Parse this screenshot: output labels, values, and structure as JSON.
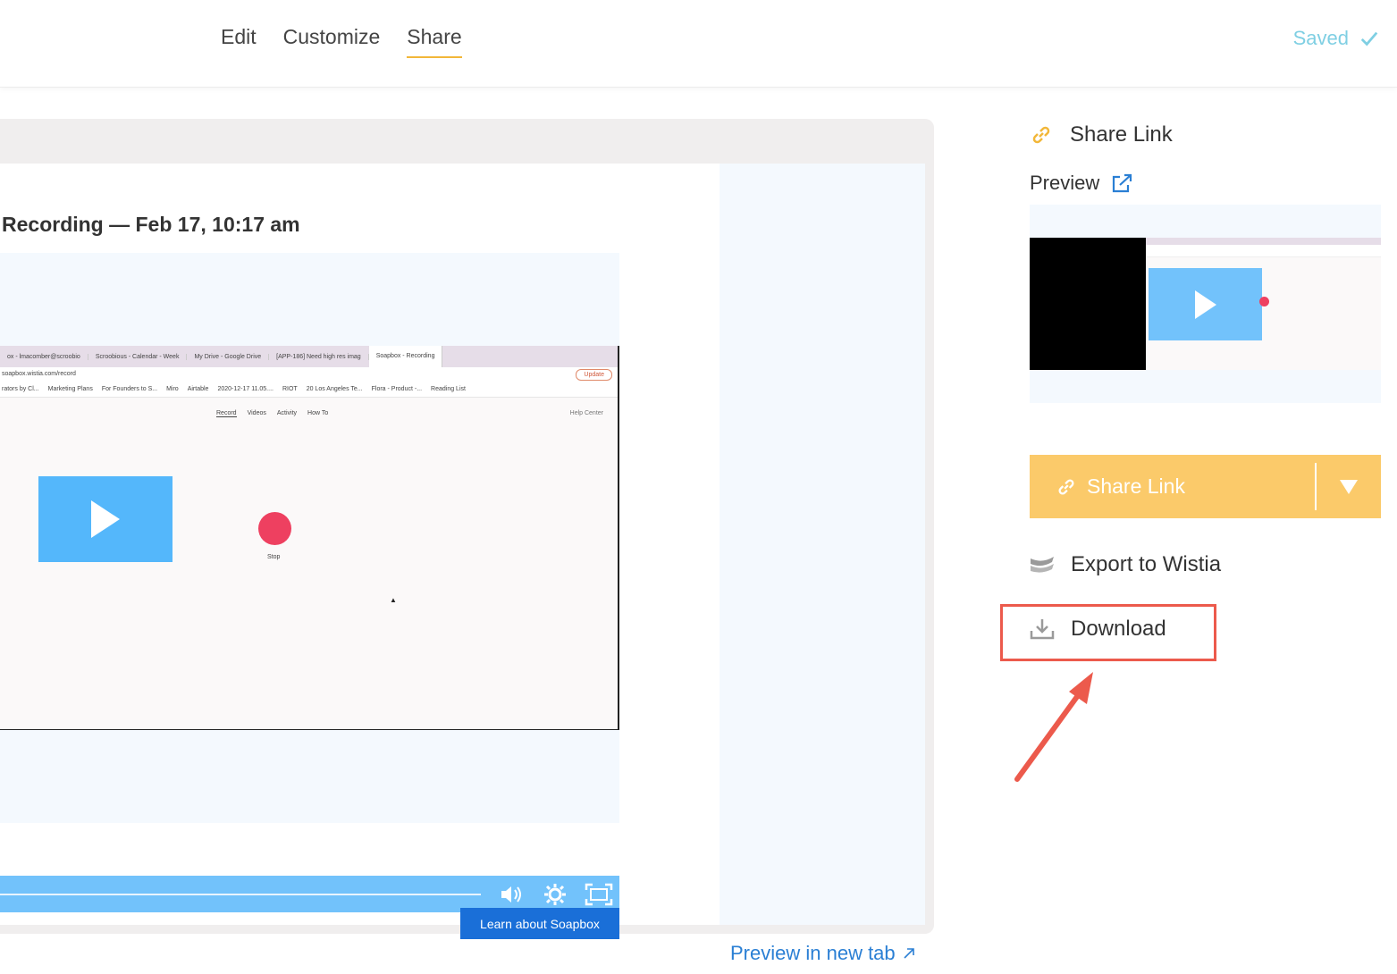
{
  "topbar": {
    "tabs": [
      {
        "label": "Edit",
        "active": false
      },
      {
        "label": "Customize",
        "active": false
      },
      {
        "label": "Share",
        "active": true
      }
    ],
    "saved_label": "Saved"
  },
  "preview": {
    "recording_title": "Recording — Feb 17, 10:17 am",
    "browser_tabs": [
      "ox - lmacomber@scroobio",
      "Scroobious - Calendar - Week",
      "My Drive - Google Drive",
      "[APP-186] Need high res imag",
      "Soapbox - Recording"
    ],
    "browser_url": "soapbox.wistia.com/record",
    "browser_update": "Update",
    "bookmarks": [
      "rators by Cl...",
      "Marketing Plans",
      "For Founders to S...",
      "Miro",
      "Airtable",
      "2020-12-17 11.05....",
      "RIOT",
      "20 Los Angeles Te...",
      "Flora - Product -...",
      "Reading List"
    ],
    "app_nav": [
      "Record",
      "Videos",
      "Activity",
      "How To"
    ],
    "app_help": "Help Center",
    "stop_label": "Stop",
    "learn_button": "Learn about Soapbox",
    "preview_new_tab": "Preview in new tab"
  },
  "panel": {
    "share_link_title": "Share Link",
    "preview_label": "Preview",
    "share_button_label": "Share Link",
    "export_label": "Export to Wistia",
    "download_label": "Download"
  },
  "colors": {
    "accent_yellow": "#fbca6a",
    "tab_underline": "#f2b739",
    "link_blue": "#2a7fd4",
    "player_blue": "#72c2fb",
    "record_red": "#ee4060",
    "annotation_red": "#ec5a4c",
    "saved_teal": "#7fcfe3"
  }
}
